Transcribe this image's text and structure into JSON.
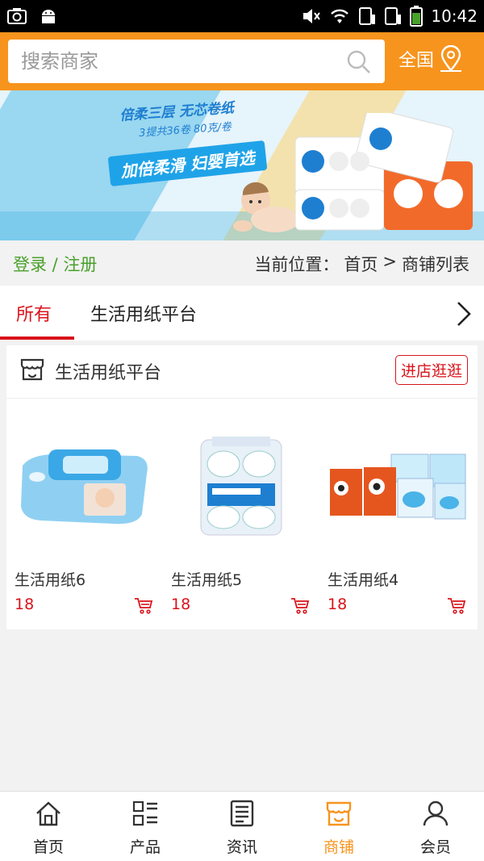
{
  "status_bar": {
    "time": "10:42"
  },
  "header": {
    "search_placeholder": "搜索商家",
    "region_label": "全国"
  },
  "banner": {
    "line1": "倍柔三层  无芯卷纸",
    "line2": "3提共36卷   80克/卷",
    "badge": "加倍柔滑  妇婴首选"
  },
  "crumbbar": {
    "login": "登录 / 注册",
    "location_label": "当前位置：",
    "home": "首页",
    "separator": ">",
    "current": "商铺列表"
  },
  "tabs": [
    {
      "label": "所有",
      "active": true
    },
    {
      "label": "生活用纸平台",
      "active": false
    }
  ],
  "shop": {
    "name": "生活用纸平台",
    "visit_label": "进店逛逛",
    "products": [
      {
        "name": "生活用纸6",
        "price": "18"
      },
      {
        "name": "生活用纸5",
        "price": "18"
      },
      {
        "name": "生活用纸4",
        "price": "18"
      }
    ]
  },
  "bottom_nav": [
    {
      "label": "首页",
      "icon": "home-icon",
      "active": false
    },
    {
      "label": "产品",
      "icon": "grid-list-icon",
      "active": false
    },
    {
      "label": "资讯",
      "icon": "news-icon",
      "active": false
    },
    {
      "label": "商铺",
      "icon": "shop-icon",
      "active": true
    },
    {
      "label": "会员",
      "icon": "user-icon",
      "active": false
    }
  ],
  "colors": {
    "accent": "#f7941d",
    "price": "#d9141b",
    "login": "#4aa02c"
  }
}
